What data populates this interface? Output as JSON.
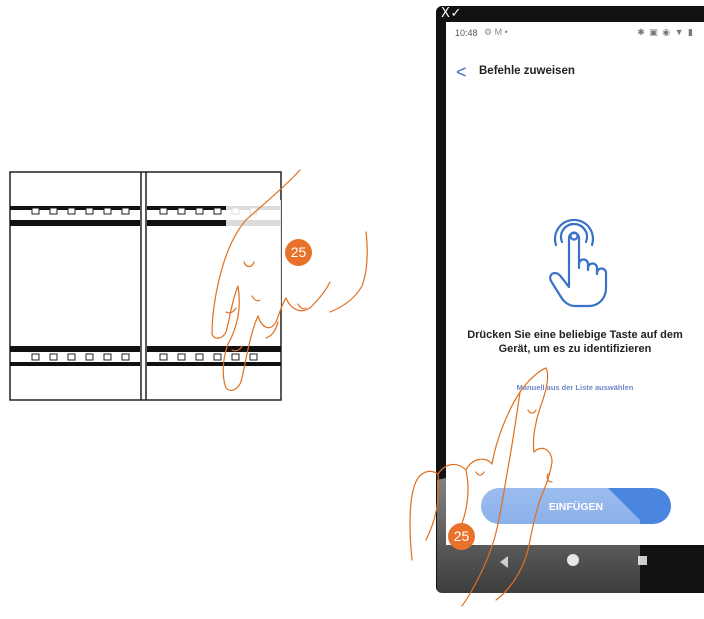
{
  "step_number": "25",
  "phone": {
    "top_mark": "X ✓",
    "status": {
      "time": "10:48",
      "left_icons": "⚙  M  •",
      "right_icons": "✱ ▣ ◉ ▼ ▮"
    },
    "appbar": {
      "back_label": "<",
      "title": "Befehle zuweisen"
    },
    "instruction": "Drücken Sie eine beliebige Taste auf dem Gerät, um es zu identifizieren",
    "manual_link": "Manuell aus der Liste auswählen",
    "insert_button": "EINFÜGEN"
  },
  "colors": {
    "accent": "#4a86e0",
    "badge": "#e8722c",
    "link": "#6f86c8",
    "icon": "#3a72c9"
  }
}
